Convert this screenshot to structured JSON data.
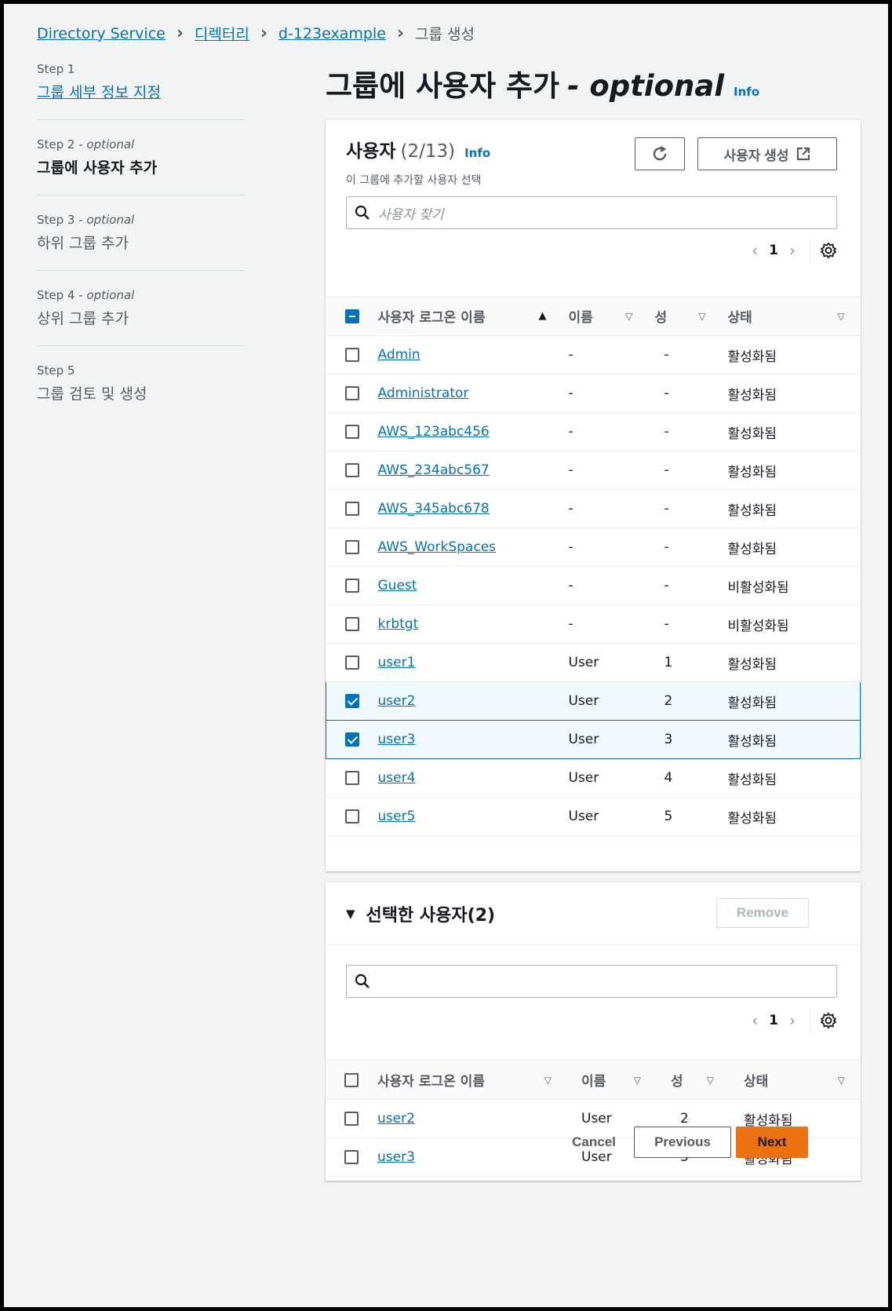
{
  "breadcrumb": {
    "items": [
      "Directory Service",
      "디렉터리",
      "d-123example"
    ],
    "current": "그룹 생성"
  },
  "steps": [
    {
      "num": "Step 1",
      "opt": "",
      "title": "그룹 세부 정보 지정",
      "state": "link"
    },
    {
      "num": "Step 2",
      "opt": " - optional",
      "title": "그룹에 사용자 추가",
      "state": "active"
    },
    {
      "num": "Step 3",
      "opt": " - optional",
      "title": "하위 그룹 추가",
      "state": "normal"
    },
    {
      "num": "Step 4",
      "opt": " - optional",
      "title": "상위 그룹 추가",
      "state": "normal"
    },
    {
      "num": "Step 5",
      "opt": "",
      "title": "그룹 검토 및 생성",
      "state": "normal"
    }
  ],
  "page": {
    "title": "그룹에 사용자 추가",
    "optional": "- optional",
    "info": "Info"
  },
  "users_panel": {
    "title": "사용자",
    "count": "(2/13)",
    "info": "Info",
    "description": "이 그룹에 추가할 사용자 선택",
    "create_label": "사용자 생성",
    "search_placeholder": "사용자 찾기",
    "page": "1",
    "columns": [
      "사용자 로그온 이름",
      "이름",
      "성",
      "상태"
    ],
    "rows": [
      {
        "login": "Admin",
        "name": "-",
        "last": "-",
        "status": "활성화됨",
        "checked": false
      },
      {
        "login": "Administrator",
        "name": "-",
        "last": "-",
        "status": "활성화됨",
        "checked": false
      },
      {
        "login": "AWS_123abc456",
        "name": "-",
        "last": "-",
        "status": "활성화됨",
        "checked": false
      },
      {
        "login": "AWS_234abc567",
        "name": "-",
        "last": "-",
        "status": "활성화됨",
        "checked": false
      },
      {
        "login": "AWS_345abc678",
        "name": "-",
        "last": "-",
        "status": "활성화됨",
        "checked": false
      },
      {
        "login": "AWS_WorkSpaces",
        "name": "-",
        "last": "-",
        "status": "활성화됨",
        "checked": false
      },
      {
        "login": "Guest",
        "name": "-",
        "last": "-",
        "status": "비활성화됨",
        "checked": false
      },
      {
        "login": "krbtgt",
        "name": "-",
        "last": "-",
        "status": "비활성화됨",
        "checked": false
      },
      {
        "login": "user1",
        "name": "User",
        "last": "1",
        "status": "활성화됨",
        "checked": false
      },
      {
        "login": "user2",
        "name": "User",
        "last": "2",
        "status": "활성화됨",
        "checked": true
      },
      {
        "login": "user3",
        "name": "User",
        "last": "3",
        "status": "활성화됨",
        "checked": true
      },
      {
        "login": "user4",
        "name": "User",
        "last": "4",
        "status": "활성화됨",
        "checked": false
      },
      {
        "login": "user5",
        "name": "User",
        "last": "5",
        "status": "활성화됨",
        "checked": false
      }
    ]
  },
  "selected_panel": {
    "title": "선택한 사용자(2)",
    "remove_label": "Remove",
    "search_placeholder": "",
    "page": "1",
    "columns": [
      "사용자 로그온 이름",
      "이름",
      "성",
      "상태"
    ],
    "rows": [
      {
        "login": "user2",
        "name": "User",
        "last": "2",
        "status": "활성화됨"
      },
      {
        "login": "user3",
        "name": "User",
        "last": "3",
        "status": "활성화됨"
      }
    ]
  },
  "footer": {
    "cancel": "Cancel",
    "previous": "Previous",
    "next": "Next"
  },
  "colors": {
    "link": "#0073bb",
    "primary": "#ec7211",
    "selected_bg": "#f1faff"
  }
}
